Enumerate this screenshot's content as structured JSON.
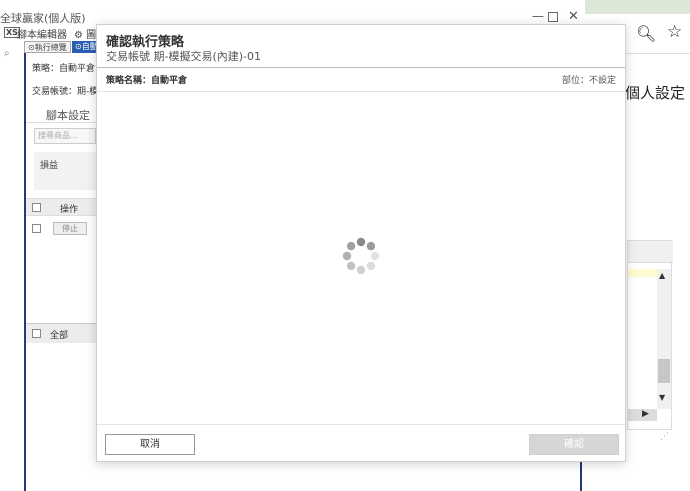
{
  "window": {
    "title": "全球贏家(個人版)"
  },
  "menu": {
    "editor_label": "腳本編輯器",
    "chart_label": "圖",
    "editor_icon_text": "XS"
  },
  "side_search": {
    "icon": "search-icon"
  },
  "tabs": {
    "overview_label": "執行總覽",
    "auto_label": "自動"
  },
  "left_panel": {
    "strategy_text": "策略：自動平倉",
    "account_text": "交易帳號：期-模",
    "script_tab_label": "腳本設定",
    "search_placeholder": "搜尋商品...",
    "pnl_label": "損益",
    "op_header": "操作",
    "stop_label": "停止",
    "all_label": "全部"
  },
  "browser": {
    "zoom_icon": "zoom-out-icon",
    "star_icon": "star-icon",
    "personal_settings": "個人設定"
  },
  "modal": {
    "title": "確認執行策略",
    "subtitle": "交易帳號 期-模擬交易(內建)-01",
    "strategy_name": "策略名稱：自動平倉",
    "position": "部位：不設定",
    "cancel_label": "取消",
    "confirm_label": "確認",
    "loading_icon": "loading-spinner-icon"
  },
  "colors": {
    "accent": "#2b5eb0",
    "frame": "#22397a",
    "disabled_button": "#d6d6d6"
  }
}
